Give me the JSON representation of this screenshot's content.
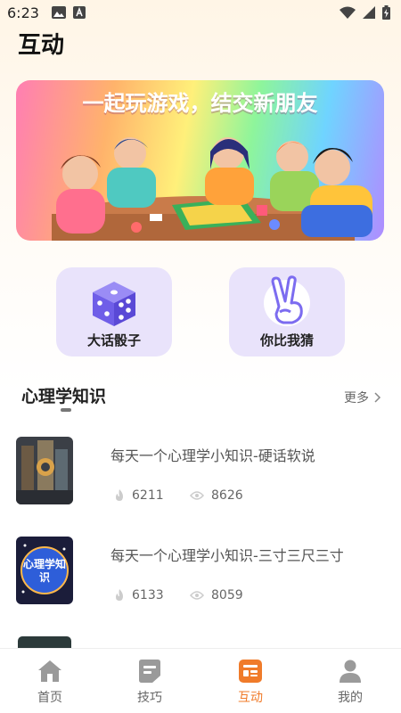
{
  "status_bar": {
    "time": "6:23"
  },
  "page_title": "互动",
  "banner": {
    "text": "一起玩游戏，结交新朋友"
  },
  "quick_actions": [
    {
      "label": "大话骰子",
      "icon": "dice-icon"
    },
    {
      "label": "你比我猜",
      "icon": "victory-hand-icon"
    }
  ],
  "section": {
    "title": "心理学知识",
    "more": "更多"
  },
  "articles": [
    {
      "title": "每天一个心理学小知识-硬话软说",
      "likes": "6211",
      "views": "8626"
    },
    {
      "title": "每天一个心理学小知识-三寸三尺三寸",
      "likes": "6133",
      "views": "8059",
      "thumb_text": "心理学知识"
    }
  ],
  "tabs": [
    {
      "label": "首页",
      "icon": "home-icon"
    },
    {
      "label": "技巧",
      "icon": "tips-icon"
    },
    {
      "label": "互动",
      "icon": "interact-icon"
    },
    {
      "label": "我的",
      "icon": "profile-icon"
    }
  ],
  "colors": {
    "accent": "#f07b2a",
    "quick_bg": "#e9e3fb",
    "icon_purple": "#7c6cf0"
  }
}
